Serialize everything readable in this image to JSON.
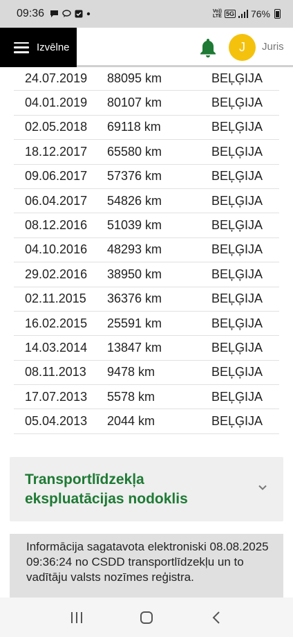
{
  "status_bar": {
    "time": "09:36",
    "network_top": "Vo))",
    "network_bottom": "LTE",
    "signal_label": "5G",
    "battery": "76%"
  },
  "header": {
    "menu_label": "Izvēlne",
    "avatar_initial": "J",
    "user_name": "Juris",
    "bell_color": "#1e7a34",
    "avatar_color": "#f4c20d"
  },
  "history": [
    {
      "date": "24.07.2019",
      "mileage": "88095 km",
      "country": "BEĻĢIJA"
    },
    {
      "date": "04.01.2019",
      "mileage": "80107 km",
      "country": "BEĻĢIJA"
    },
    {
      "date": "02.05.2018",
      "mileage": "69118 km",
      "country": "BEĻĢIJA"
    },
    {
      "date": "18.12.2017",
      "mileage": "65580 km",
      "country": "BEĻĢIJA"
    },
    {
      "date": "09.06.2017",
      "mileage": "57376 km",
      "country": "BEĻĢIJA"
    },
    {
      "date": "06.04.2017",
      "mileage": "54826 km",
      "country": "BEĻĢIJA"
    },
    {
      "date": "08.12.2016",
      "mileage": "51039 km",
      "country": "BEĻĢIJA"
    },
    {
      "date": "04.10.2016",
      "mileage": "48293 km",
      "country": "BEĻĢIJA"
    },
    {
      "date": "29.02.2016",
      "mileage": "38950 km",
      "country": "BEĻĢIJA"
    },
    {
      "date": "02.11.2015",
      "mileage": "36376 km",
      "country": "BEĻĢIJA"
    },
    {
      "date": "16.02.2015",
      "mileage": "25591 km",
      "country": "BEĻĢIJA"
    },
    {
      "date": "14.03.2014",
      "mileage": "13847 km",
      "country": "BEĻĢIJA"
    },
    {
      "date": "08.11.2013",
      "mileage": "9478 km",
      "country": "BEĻĢIJA"
    },
    {
      "date": "17.07.2013",
      "mileage": "5578 km",
      "country": "BEĻĢIJA"
    },
    {
      "date": "05.04.2013",
      "mileage": "2044 km",
      "country": "BEĻĢIJA"
    }
  ],
  "accordion": {
    "title": "Transportlīdzekļa ekspluatācijas nodoklis",
    "title_color": "#1e7a34"
  },
  "info": {
    "text": "Informācija sagatavota elektroniski 08.08.2025 09:36:24 no CSDD transportlīdzekļu un to vadītāju valsts nozīmes reģistra."
  }
}
